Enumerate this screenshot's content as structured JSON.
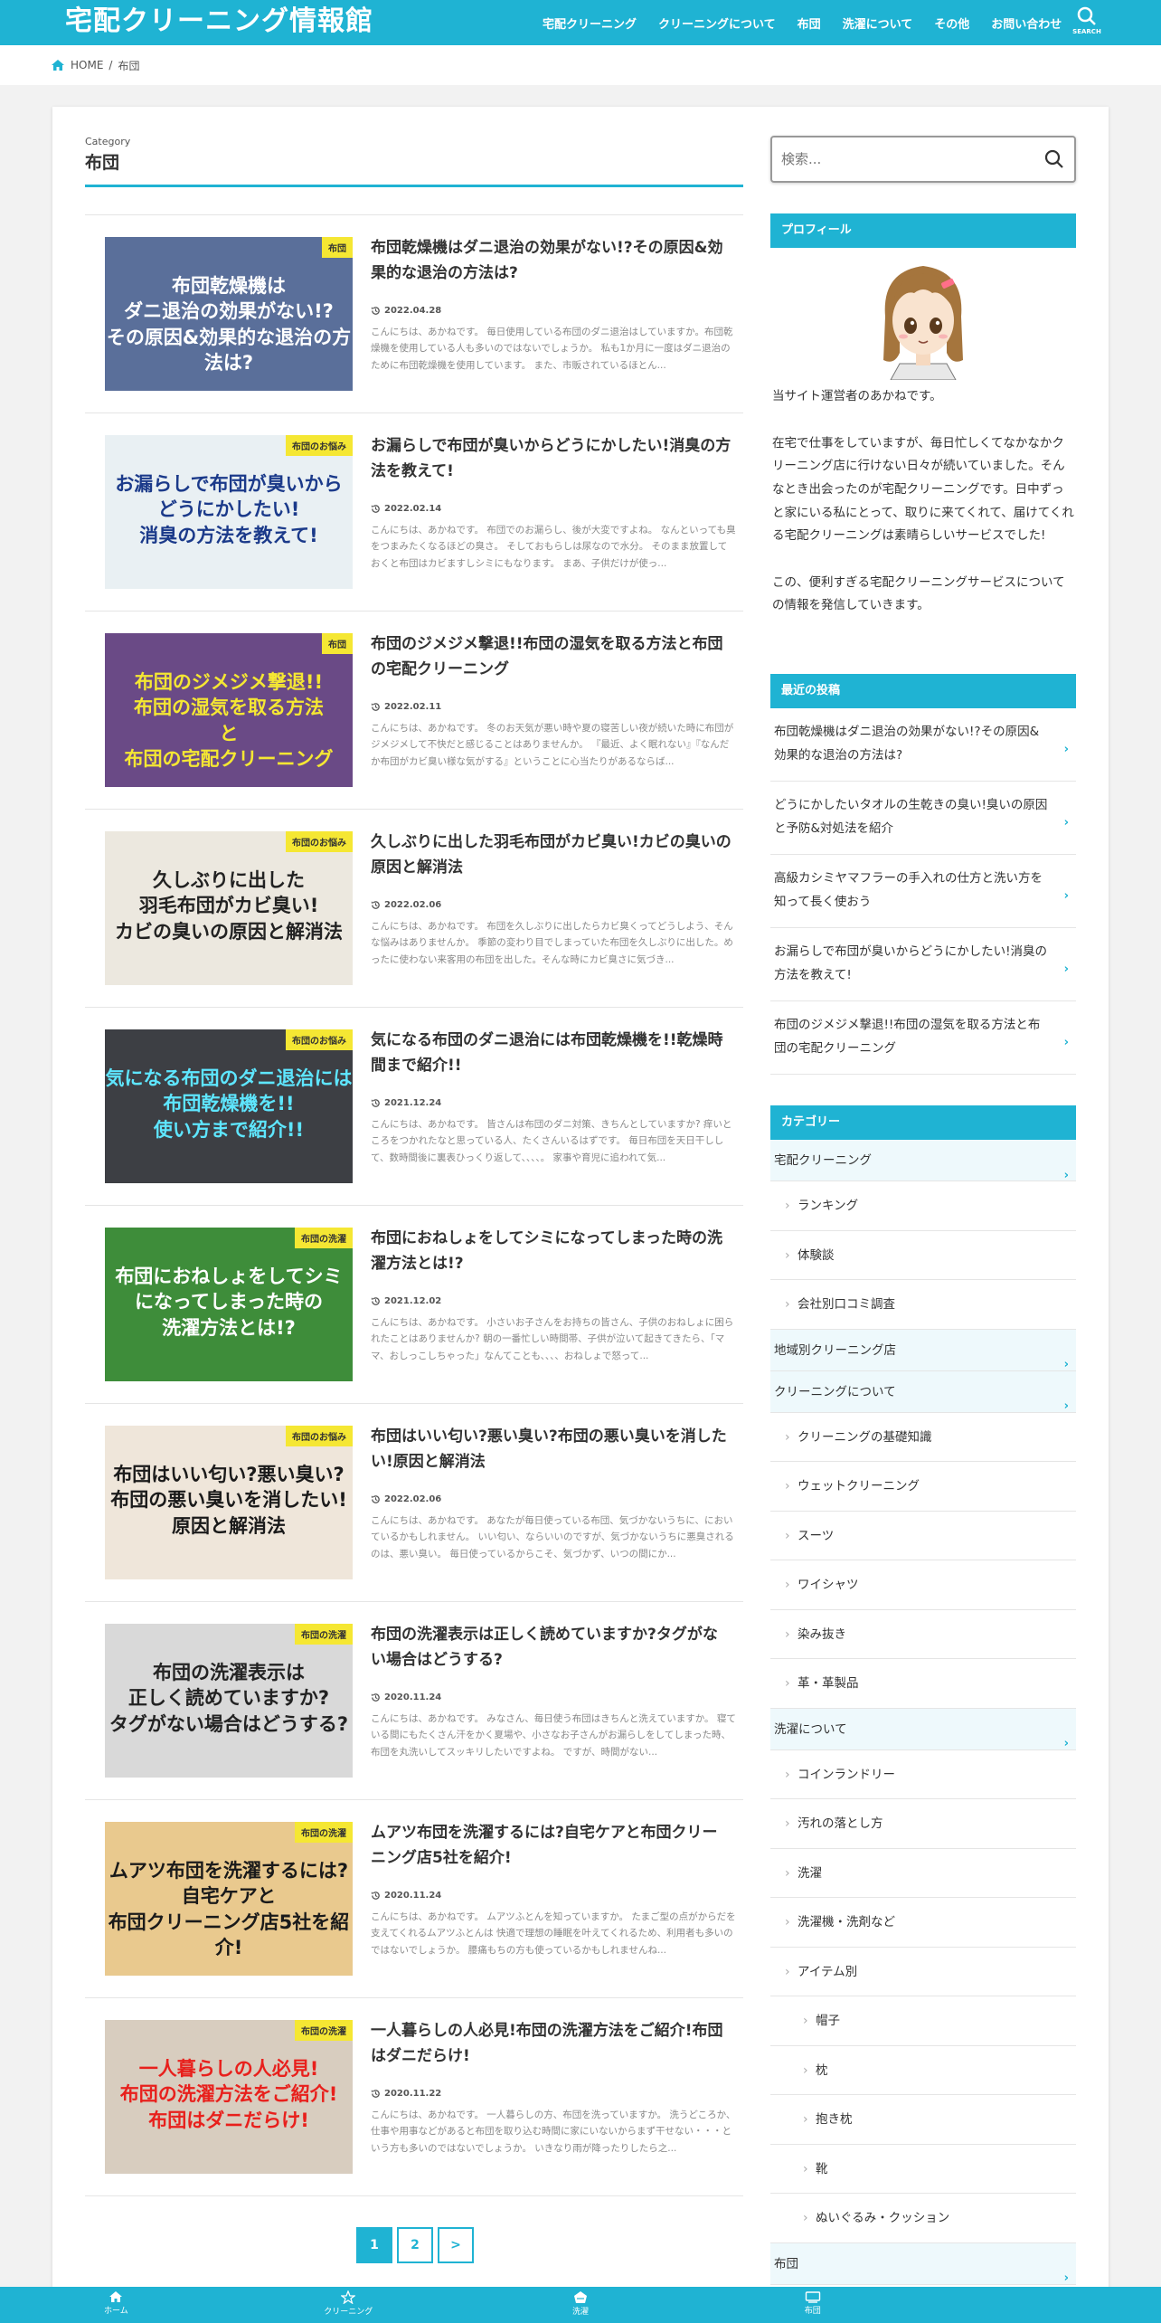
{
  "header": {
    "site_title": "宅配クリーニング情報館",
    "nav": [
      "宅配クリーニング",
      "クリーニングについて",
      "布団",
      "洗濯について",
      "その他",
      "お問い合わせ"
    ],
    "search_label": "SEARCH"
  },
  "breadcrumb": {
    "home": "HOME",
    "current": "布団"
  },
  "category_header": {
    "label": "Category",
    "title": "布団"
  },
  "posts": [
    {
      "title": "布団乾燥機はダニ退治の効果がない!?その原因&効果的な退治の方法は?",
      "date": "2022.04.28",
      "badge": "布団",
      "excerpt": "こんにちは、あかねです。 毎日使用している布団のダニ退治はしていますか。布団乾燥機を使用している人も多いのではないでしょうか。 私も1か月に一度はダニ退治のために布団乾燥機を使用しています。 また、市販されているほとん...",
      "thumb_text": "布団乾燥機は\nダニ退治の効果がない!?\nその原因&効果的な退治の方法は?",
      "thumb_bg": "#5a6f9a",
      "thumb_color": "#ffffff"
    },
    {
      "title": "お漏らしで布団が臭いからどうにかしたい!消臭の方法を教えて!",
      "date": "2022.02.14",
      "badge": "布団のお悩み",
      "excerpt": "こんにちは、あかねです。 布団でのお漏らし、後が大変ですよね。 なんといっても臭をつまみたくなるほどの臭さ。 そしておもらしは尿なので水分。 そのまま放置しておくと布団はカビますしシミにもなります。 まあ、子供だけが使っ...",
      "thumb_text": "お漏らしで布団が臭いから\nどうにかしたい!\n消臭の方法を教えて!",
      "thumb_bg": "#e9f0f3",
      "thumb_color": "#1b3a8a"
    },
    {
      "title": "布団のジメジメ撃退!!布団の湿気を取る方法と布団の宅配クリーニング",
      "date": "2022.02.11",
      "badge": "布団",
      "excerpt": "こんにちは、あかねです。 冬のお天気が悪い時や夏の寝苦しい夜が続いた時に布団がジメジメして不快だと感じることはありませんか。 『最近、よく眠れない』『なんだか布団がカビ臭い様な気がする』ということに心当たりがあるならば...",
      "thumb_text": "布団のジメジメ撃退!!\n布団の湿気を取る方法\nと\n布団の宅配クリーニング",
      "thumb_bg": "#6a4a86",
      "thumb_color": "#f5e733"
    },
    {
      "title": "久しぶりに出した羽毛布団がカビ臭い!カビの臭いの原因と解消法",
      "date": "2022.02.06",
      "badge": "布団のお悩み",
      "excerpt": "こんにちは、あかねです。 布団を久しぶりに出したらカビ臭くってどうしよう、そんな悩みはありませんか。 季節の変わり目でしまっていた布団を久しぶりに出した。めったに使わない来客用の布団を出した。そんな時にカビ臭さに気づき...",
      "thumb_text": "久しぶりに出した\n羽毛布団がカビ臭い!\nカビの臭いの原因と解消法",
      "thumb_bg": "#ece8df",
      "thumb_color": "#222222"
    },
    {
      "title": "気になる布団のダニ退治には布団乾燥機を!!乾燥時間まで紹介!!",
      "date": "2021.12.24",
      "badge": "布団のお悩み",
      "excerpt": "こんにちは、あかねです。 皆さんは布団のダニ対策、きちんとしていますか? 痒いところをつかれたなと思っている人、たくさんいるはずです。 毎日布団を天日干しして、数時間後に裏表ひっくり返して、、、、。 家事や育児に追われて気...",
      "thumb_text": "気になる布団のダニ退治には\n布団乾燥機を!!\n使い方まで紹介!!",
      "thumb_bg": "#3d3f44",
      "thumb_color": "#5ee6ff"
    },
    {
      "title": "布団におねしょをしてシミになってしまった時の洗濯方法とは!?",
      "date": "2021.12.02",
      "badge": "布団の洗濯",
      "excerpt": "こんにちは、あかねです。 小さいお子さんをお持ちの皆さん、子供のおねしょに困られたことはありませんか? 朝の一番忙しい時間帯、子供が泣いて起きてきたら、「ママ、おしっこしちゃった」なんてことも、、、、おねしょで怒って...",
      "thumb_text": "布団におねしょをしてシミ\nになってしまった時の\n洗濯方法とは!?",
      "thumb_bg": "#3e8d3a",
      "thumb_color": "#ffffff"
    },
    {
      "title": "布団はいい匂い?悪い臭い?布団の悪い臭いを消したい!原因と解消法",
      "date": "2022.02.06",
      "badge": "布団のお悩み",
      "excerpt": "こんにちは、あかねです。 あなたが毎日使っている布団、気づかないうちに、においているかもしれません。 いい匂い、ならいいのですが、気づかないうちに悪臭されるのは、悪い臭い。 毎日使っているからこそ、気づかず、いつの間にか...",
      "thumb_text": "布団はいい匂い?悪い臭い?\n布団の悪い臭いを消したい!\n原因と解消法",
      "thumb_bg": "#efe6da",
      "thumb_color": "#1a1a1a"
    },
    {
      "title": "布団の洗濯表示は正しく読めていますか?タグがない場合はどうする?",
      "date": "2020.11.24",
      "badge": "布団の洗濯",
      "excerpt": "こんにちは、あかねです。 みなさん、毎日使う布団はきちんと洗えていますか。 寝ている間にもたくさん汗をかく夏場や、小さなお子さんがお漏らしをしてしまった時、 布団を丸洗いしてスッキリしたいですよね。 ですが、時間がない...",
      "thumb_text": "布団の洗濯表示は\n正しく読めていますか?\nタグがない場合はどうする?",
      "thumb_bg": "#d9d9d9",
      "thumb_color": "#222222"
    },
    {
      "title": "ムアツ布団を洗濯するには?自宅ケアと布団クリーニング店5社を紹介!",
      "date": "2020.11.24",
      "badge": "布団の洗濯",
      "excerpt": "こんにちは、あかねです。 ムアツふとんを知っていますか。 たまご型の点がからだを支えてくれるムアツふとんは 快適で理想の睡眠を叶えてくれるため、利用者も多いのではないでしょうか。 腰痛もちの方も使っているかもしれませんね...",
      "thumb_text": "ムアツ布団を洗濯するには?\n自宅ケアと\n布団クリーニング店5社を紹介!",
      "thumb_bg": "#e9c98e",
      "thumb_color": "#1a1a1a"
    },
    {
      "title": "一人暮らしの人必見!布団の洗濯方法をご紹介!布団はダニだらけ!",
      "date": "2020.11.22",
      "badge": "布団の洗濯",
      "excerpt": "こんにちは、あかねです。 一人暮らしの方、布団を洗っていますか。 洗うどころか、仕事や用事などがあると布団を取り込む時間に家にいないからまず干せない・・・という方も多いのではないでしょうか。 いきなり雨が降ったりしたら之...",
      "thumb_text": "一人暮らしの人必見!\n布団の洗濯方法をご紹介!\n布団はダニだらけ!",
      "thumb_bg": "#d8cdbf",
      "thumb_color": "#e8201c"
    }
  ],
  "pagination": {
    "current": "1",
    "pages": [
      "1",
      "2"
    ],
    "next": ">"
  },
  "sidebar": {
    "search_placeholder": "検索...",
    "profile": {
      "heading": "プロフィール",
      "paragraphs": [
        "当サイト運営者のあかねです。",
        "在宅で仕事をしていますが、毎日忙しくてなかなかクリーニング店に行けない日々が続いていました。そんなとき出会ったのが宅配クリーニングです。日中ずっと家にいる私にとって、取りに来てくれて、届けてくれる宅配クリーニングは素晴らしいサービスでした!",
        "この、便利すぎる宅配クリーニングサービスについての情報を発信していきます。"
      ]
    },
    "recent": {
      "heading": "最近の投稿",
      "items": [
        "布団乾燥機はダニ退治の効果がない!?その原因&効果的な退治の方法は?",
        "どうにかしたいタオルの生乾きの臭い!臭いの原因と予防&対処法を紹介",
        "高級カシミヤマフラーの手入れの仕方と洗い方を知って長く使おう",
        "お漏らしで布団が臭いからどうにかしたい!消臭の方法を教えて!",
        "布団のジメジメ撃退!!布団の湿気を取る方法と布団の宅配クリーニング"
      ]
    },
    "categories": {
      "heading": "カテゴリー",
      "items": [
        {
          "label": "宅配クリーニング",
          "level": "top"
        },
        {
          "label": "ランキング",
          "level": "child"
        },
        {
          "label": "体験談",
          "level": "child"
        },
        {
          "label": "会社別口コミ調査",
          "level": "child"
        },
        {
          "label": "地域別クリーニング店",
          "level": "top"
        },
        {
          "label": "クリーニングについて",
          "level": "top"
        },
        {
          "label": "クリーニングの基礎知識",
          "level": "child"
        },
        {
          "label": "ウェットクリーニング",
          "level": "child"
        },
        {
          "label": "スーツ",
          "level": "child"
        },
        {
          "label": "ワイシャツ",
          "level": "child"
        },
        {
          "label": "染み抜き",
          "level": "child"
        },
        {
          "label": "革・革製品",
          "level": "child"
        },
        {
          "label": "洗濯について",
          "level": "top"
        },
        {
          "label": "コインランドリー",
          "level": "child"
        },
        {
          "label": "汚れの落とし方",
          "level": "child"
        },
        {
          "label": "洗濯",
          "level": "child"
        },
        {
          "label": "洗濯機・洗剤など",
          "level": "child"
        },
        {
          "label": "アイテム別",
          "level": "child"
        },
        {
          "label": "帽子",
          "level": "grand"
        },
        {
          "label": "枕",
          "level": "grand"
        },
        {
          "label": "抱き枕",
          "level": "grand"
        },
        {
          "label": "靴",
          "level": "grand"
        },
        {
          "label": "ぬいぐるみ・クッション",
          "level": "grand"
        },
        {
          "label": "布団",
          "level": "top"
        }
      ]
    }
  },
  "footer_nav": [
    {
      "label": "ホーム",
      "icon": "home-icon"
    },
    {
      "label": "クリーニング",
      "icon": "star-icon"
    },
    {
      "label": "洗濯",
      "icon": "washing-icon"
    },
    {
      "label": "布団",
      "icon": "futon-icon"
    }
  ],
  "colors": {
    "accent": "#1fb3d3",
    "badge": "#f5e733",
    "category_bg": "#eef9fc"
  }
}
